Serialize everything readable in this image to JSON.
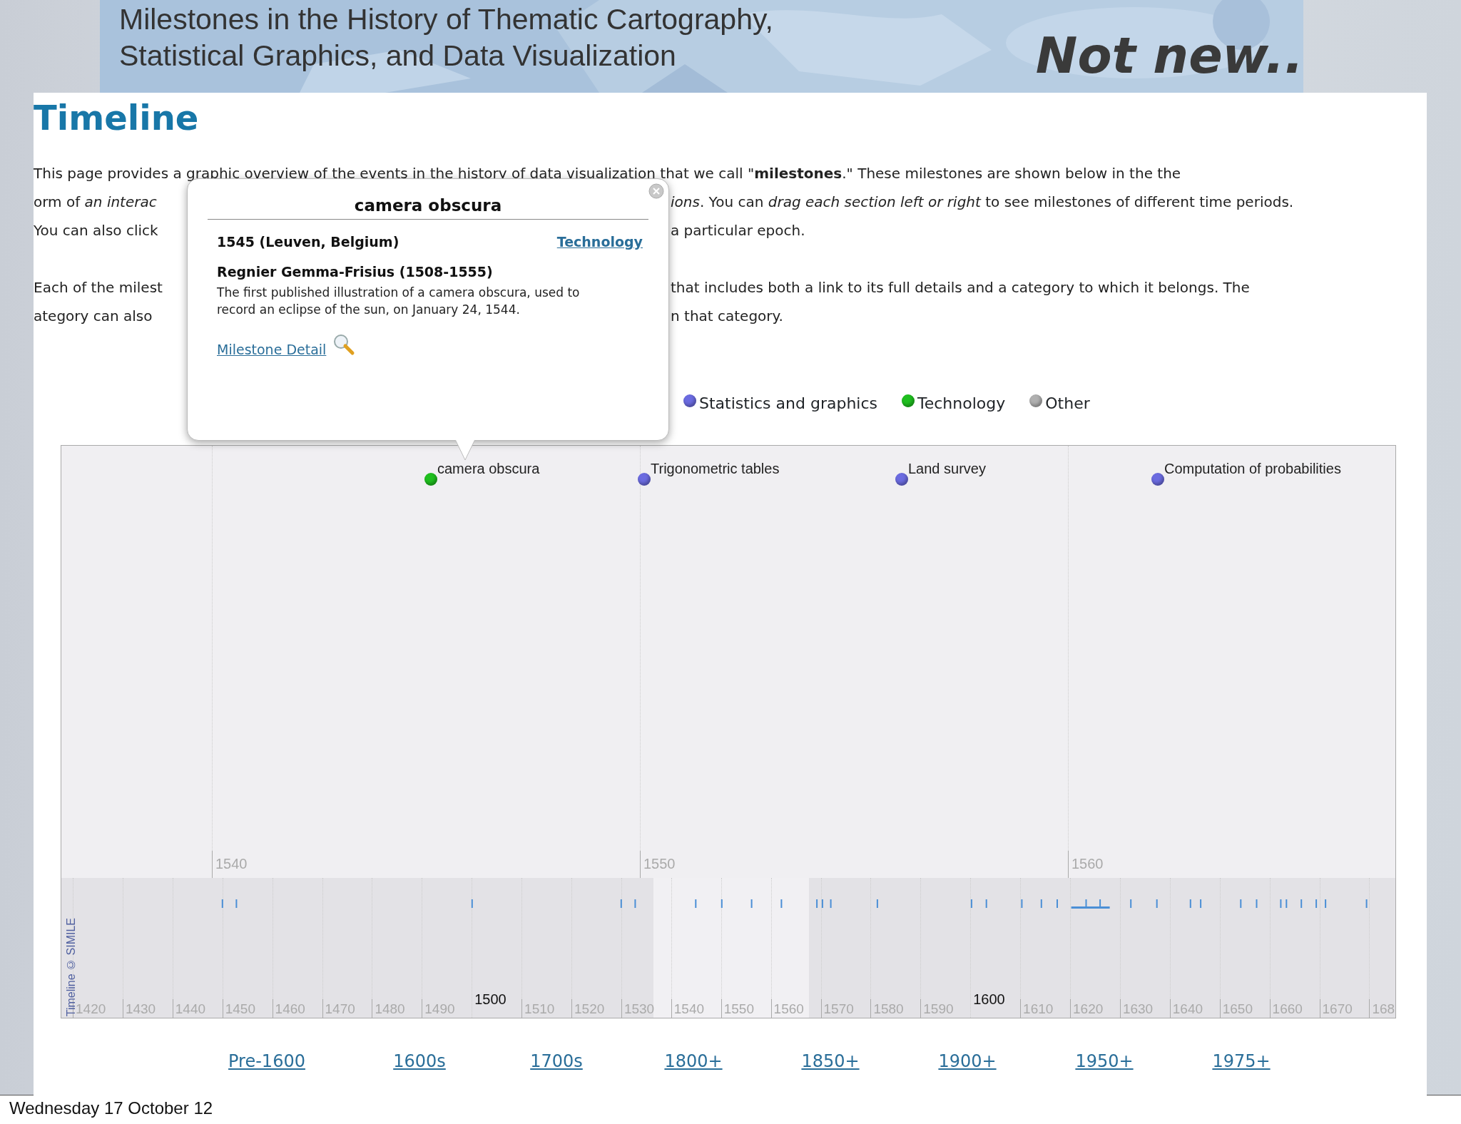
{
  "slide": {
    "banner_title": [
      "Milestones in the History of Thematic Cartography,",
      "Statistical Graphics, and Data Visualization"
    ],
    "tagline": "Not new..",
    "footer": "Wednesday 17 October 12"
  },
  "page": {
    "heading": "Timeline",
    "paragraphs": [
      {
        "lines": [
          {
            "kind": "full",
            "text": "This page provides a graphic overview of the events in the history of data visualization that we call \"**milestones**.\" These milestones are shown below in the the"
          },
          {
            "kind": "split",
            "left": "orm of *an interac*",
            "right": "*ions*. You can *drag each section left or right* to see milestones of different time periods."
          },
          {
            "kind": "split",
            "left": "You can also click",
            "right": "a particular epoch."
          }
        ]
      },
      {
        "lines": [
          {
            "kind": "split",
            "left": "Each of the milest",
            "right": "that includes both a link to its full details and a category to which it belongs. The"
          },
          {
            "kind": "split",
            "left": "ategory can also",
            "right": "n that category."
          }
        ]
      }
    ],
    "legend": [
      {
        "label": "Statistics and graphics",
        "color": "#6b6be0"
      },
      {
        "label": "Technology",
        "color": "#1fbf1f"
      },
      {
        "label": "Other",
        "color": "#b0b0b0"
      }
    ],
    "timeline": {
      "events": [
        {
          "label": "camera obscura",
          "color": "#1fbf1f"
        },
        {
          "label": "Trigonometric tables",
          "color": "#6b6be0"
        },
        {
          "label": "Land survey",
          "color": "#6b6be0"
        },
        {
          "label": "Computation of probabilities",
          "color": "#6b6be0"
        }
      ],
      "detail_ticks": [
        "1540",
        "1550",
        "1560"
      ],
      "overview_labels": [
        {
          "label": "1420",
          "kind": "decade"
        },
        {
          "label": "1430",
          "kind": "decade"
        },
        {
          "label": "1440",
          "kind": "decade"
        },
        {
          "label": "1450",
          "kind": "decade"
        },
        {
          "label": "1460",
          "kind": "decade"
        },
        {
          "label": "1470",
          "kind": "decade"
        },
        {
          "label": "1480",
          "kind": "decade"
        },
        {
          "label": "1490",
          "kind": "decade"
        },
        {
          "label": "1500",
          "kind": "century"
        },
        {
          "label": "1510",
          "kind": "decade"
        },
        {
          "label": "1520",
          "kind": "decade"
        },
        {
          "label": "1530",
          "kind": "decade"
        },
        {
          "label": "1540",
          "kind": "decade"
        },
        {
          "label": "1550",
          "kind": "decade"
        },
        {
          "label": "1560",
          "kind": "decade"
        },
        {
          "label": "1570",
          "kind": "decade"
        },
        {
          "label": "1580",
          "kind": "decade"
        },
        {
          "label": "1590",
          "kind": "decade"
        },
        {
          "label": "1600",
          "kind": "century"
        },
        {
          "label": "1610",
          "kind": "decade"
        },
        {
          "label": "1620",
          "kind": "decade"
        },
        {
          "label": "1630",
          "kind": "decade"
        },
        {
          "label": "1640",
          "kind": "decade"
        },
        {
          "label": "1650",
          "kind": "decade"
        },
        {
          "label": "1660",
          "kind": "decade"
        },
        {
          "label": "1670",
          "kind": "decade"
        },
        {
          "label": "168",
          "kind": "decade"
        }
      ],
      "credit": "Timeline © SIMILE"
    },
    "popup": {
      "title": "camera obscura",
      "date_place": "1545 (Leuven, Belgium)",
      "category": "Technology",
      "person": "Regnier Gemma-Frisius (1508-1555)",
      "description": "The first published illustration of a camera obscura, used to record an eclipse of the sun, on January 24, 1544.",
      "link": "Milestone Detail"
    },
    "epoch_links": [
      "Pre-1600",
      "1600s",
      "1700s",
      "1800+",
      "1850+",
      "1900+",
      "1950+",
      "1975+"
    ]
  }
}
